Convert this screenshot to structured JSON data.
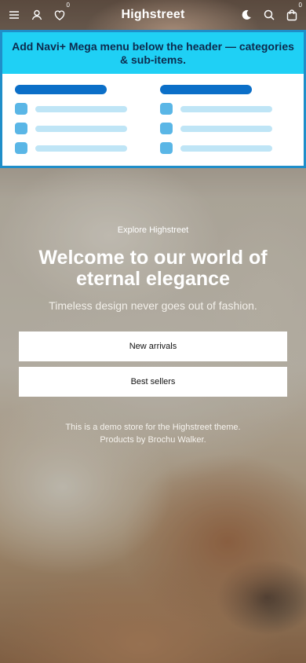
{
  "header": {
    "brand": "Highstreet",
    "wishlist_count": "0",
    "cart_count": "0",
    "icons": {
      "menu": "hamburger-icon",
      "account": "user-icon",
      "wishlist": "heart-icon",
      "theme": "moon-icon",
      "search": "search-icon",
      "cart": "bag-icon"
    }
  },
  "mega_menu": {
    "banner_text": "Add Navi+ Mega menu below the header — categories & sub-items.",
    "colors": {
      "banner_bg": "#1fd0f5",
      "border": "#1f8ec9",
      "title_bar": "#0b6fc8",
      "dot": "#5ab6e6",
      "line": "#bfe5f6"
    }
  },
  "hero": {
    "eyebrow": "Explore Highstreet",
    "headline": "Welcome to our world of eternal elegance",
    "subline": "Timeless design never goes out of fashion.",
    "buttons": [
      {
        "label": "New arrivals"
      },
      {
        "label": "Best sellers"
      }
    ],
    "note_line1": "This is a demo store for the Highstreet theme.",
    "note_line2": "Products by Brochu Walker."
  }
}
